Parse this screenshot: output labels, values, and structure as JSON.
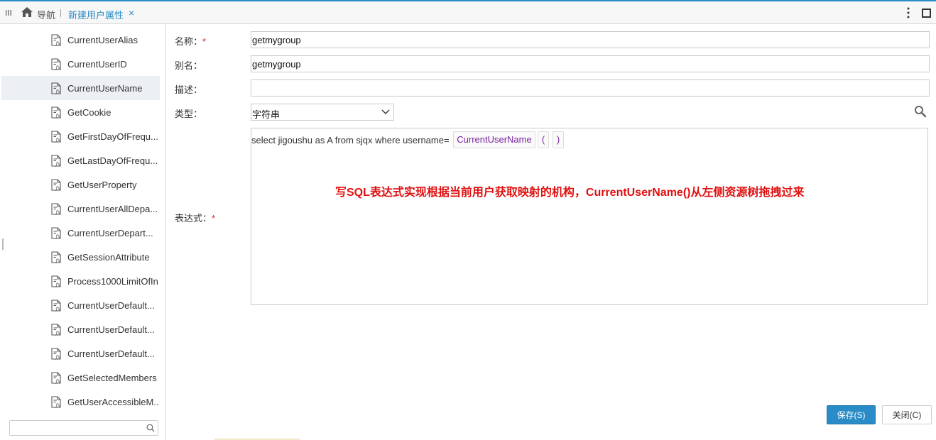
{
  "topbar": {
    "nav_label": "导航",
    "active_tab_label": "新建用户属性",
    "close_glyph": "×",
    "icons": [
      "menu-icon",
      "home-icon",
      "close-icon",
      "more-vertical-icon",
      "maximize-icon"
    ]
  },
  "sidebar": {
    "items": [
      {
        "label": "CurrentUserAlias",
        "icon": "function-file-icon"
      },
      {
        "label": "CurrentUserID",
        "icon": "function-file-icon"
      },
      {
        "label": "CurrentUserName",
        "icon": "function-file-icon",
        "selected": true
      },
      {
        "label": "GetCookie",
        "icon": "function-file-icon"
      },
      {
        "label": "GetFirstDayOfFrequ...",
        "icon": "function-file-icon"
      },
      {
        "label": "GetLastDayOfFrequ...",
        "icon": "function-file-icon"
      },
      {
        "label": "GetUserProperty",
        "icon": "function-file-icon"
      },
      {
        "label": "CurrentUserAllDepa...",
        "icon": "function-file-icon"
      },
      {
        "label": "CurrentUserDepart...",
        "icon": "function-file-icon"
      },
      {
        "label": "GetSessionAttribute",
        "icon": "function-file-icon"
      },
      {
        "label": "Process1000LimitOfIn",
        "icon": "function-file-icon"
      },
      {
        "label": "CurrentUserDefault...",
        "icon": "function-file-icon"
      },
      {
        "label": "CurrentUserDefault...",
        "icon": "function-file-icon"
      },
      {
        "label": "CurrentUserDefault...",
        "icon": "function-file-icon"
      },
      {
        "label": "GetSelectedMembers",
        "icon": "function-file-icon"
      },
      {
        "label": "GetUserAccessibleM...",
        "icon": "function-file-icon"
      }
    ],
    "search_placeholder": ""
  },
  "form": {
    "name_label": "名称：",
    "name_value": "getmygroup",
    "alias_label": "别名：",
    "alias_value": "getmygroup",
    "desc_label": "描述：",
    "desc_value": "",
    "type_label": "类型：",
    "type_value": "字符串",
    "expr_label": "表达式：",
    "required_mark": "*",
    "expression": {
      "text": "select jigoushu as A from sjqx where username=",
      "function_token": "CurrentUserName",
      "open_paren": "(",
      "close_paren": ")"
    },
    "annotation": "写SQL表达式实现根据当前用户获取映射的机构，CurrentUserName()从左侧资源树拖拽过来"
  },
  "buttons": {
    "save_label": "保存(S)",
    "close_label": "关闭(C)"
  },
  "colors": {
    "accent": "#2a8cc6",
    "required": "#e02020",
    "annotation": "#e01010",
    "token": "#7a1fa0"
  }
}
